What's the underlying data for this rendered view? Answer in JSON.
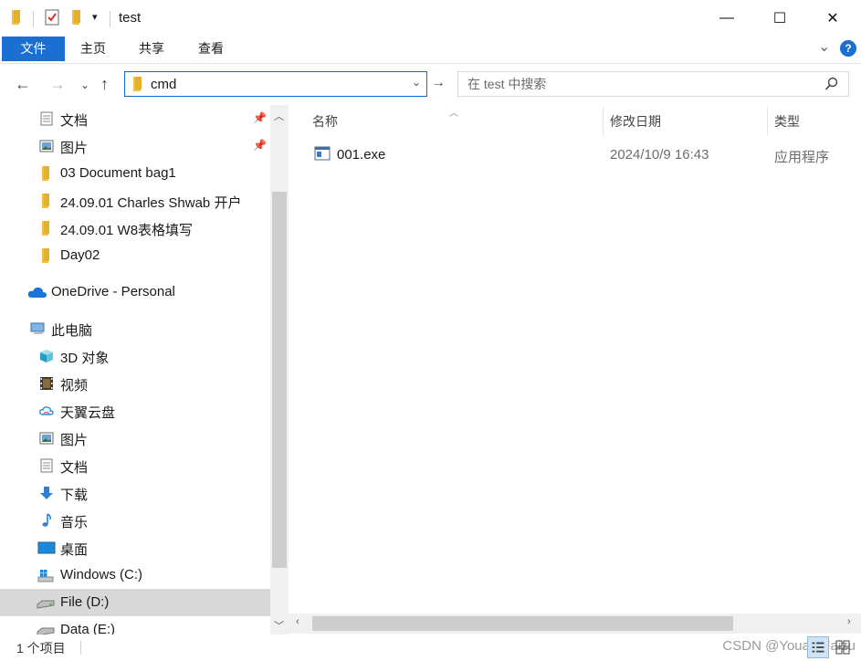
{
  "window": {
    "title": "test",
    "minimize": "—",
    "maximize": "☐",
    "close": "✕"
  },
  "ribbon": {
    "tabs": [
      "文件",
      "主页",
      "共享",
      "查看"
    ],
    "expand": "⌄",
    "help": "?"
  },
  "address": {
    "path": "cmd",
    "search_placeholder": "在 test 中搜索"
  },
  "nav_pane": {
    "items": [
      {
        "label": "文档",
        "icon": "documents-icon",
        "pinned": true
      },
      {
        "label": "图片",
        "icon": "pictures-icon",
        "pinned": true
      },
      {
        "label": "03 Document bag1",
        "icon": "folder-icon"
      },
      {
        "label": "24.09.01 Charles Shwab 开户",
        "icon": "folder-icon"
      },
      {
        "label": "24.09.01 W8表格填写",
        "icon": "folder-icon"
      },
      {
        "label": "Day02",
        "icon": "folder-icon"
      },
      {
        "label": "OneDrive - Personal",
        "icon": "onedrive-icon"
      },
      {
        "label": "此电脑",
        "icon": "this-pc-icon"
      },
      {
        "label": "3D 对象",
        "icon": "3d-objects-icon"
      },
      {
        "label": "视频",
        "icon": "videos-icon"
      },
      {
        "label": "天翼云盘",
        "icon": "cloud-drive-icon"
      },
      {
        "label": "图片",
        "icon": "pictures-icon"
      },
      {
        "label": "文档",
        "icon": "documents-icon"
      },
      {
        "label": "下载",
        "icon": "downloads-icon"
      },
      {
        "label": "音乐",
        "icon": "music-icon"
      },
      {
        "label": "桌面",
        "icon": "desktop-icon"
      },
      {
        "label": "Windows (C:)",
        "icon": "windows-drive-icon"
      },
      {
        "label": "File (D:)",
        "icon": "drive-icon",
        "selected": true
      },
      {
        "label": "Data (E:)",
        "icon": "drive-icon"
      }
    ]
  },
  "file_list": {
    "columns": [
      "名称",
      "修改日期",
      "类型"
    ],
    "rows": [
      {
        "name": "001.exe",
        "modified": "2024/10/9 16:43",
        "type": "应用程序",
        "icon": "exe-file-icon"
      }
    ]
  },
  "status": {
    "count": "1 个项目",
    "watermark": "CSDN @YouareFaizu"
  },
  "colors": {
    "accent": "#1a6fd1",
    "selected_bg": "#d9d9d9",
    "folder": "#f0c244"
  }
}
